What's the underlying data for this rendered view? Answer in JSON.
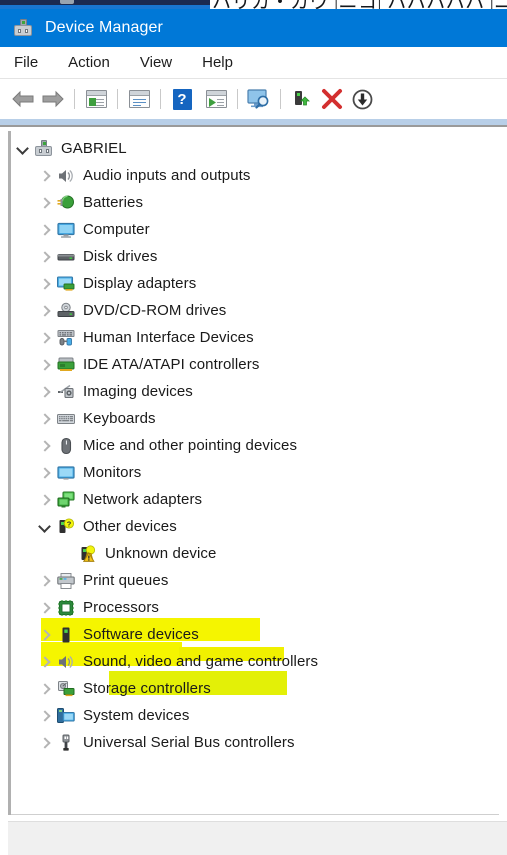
{
  "top_sliver": {
    "partial_text": "ハリカ・カウ |ニコ| ハハハハハ |ニヘ ハハ ハヘ ハハヘ"
  },
  "window": {
    "title": "Device Manager",
    "title_icon": "device-manager-icon"
  },
  "menubar": {
    "items": [
      {
        "label": "File",
        "name": "menu-file"
      },
      {
        "label": "Action",
        "name": "menu-action"
      },
      {
        "label": "View",
        "name": "menu-view"
      },
      {
        "label": "Help",
        "name": "menu-help"
      }
    ]
  },
  "toolbar": {
    "buttons": [
      {
        "icon": "back-arrow-icon",
        "tip": "Back"
      },
      {
        "icon": "forward-arrow-icon",
        "tip": "Forward"
      },
      {
        "icon": "show-hide-console-tree-icon",
        "tip": "Show/Hide console tree"
      },
      {
        "icon": "properties-icon",
        "tip": "Properties"
      },
      {
        "icon": "help-icon",
        "tip": "Help"
      },
      {
        "icon": "update-driver-software-icon",
        "tip": "Update driver"
      },
      {
        "icon": "scan-for-hardware-changes-icon",
        "tip": "Scan for hardware changes"
      },
      {
        "icon": "enable-device-icon",
        "tip": "Enable device"
      },
      {
        "icon": "uninstall-device-icon",
        "tip": "Uninstall device"
      },
      {
        "icon": "disable-device-icon",
        "tip": "Disable device"
      }
    ]
  },
  "tree": {
    "root": {
      "label": "GABRIEL",
      "icon": "computer-root-icon",
      "expanded": true
    },
    "items": [
      {
        "label": "Audio inputs and outputs",
        "icon": "speaker-icon",
        "depth": 1,
        "expanded": false,
        "highlighted": false
      },
      {
        "label": "Batteries",
        "icon": "battery-icon",
        "depth": 1,
        "expanded": false,
        "highlighted": false
      },
      {
        "label": "Computer",
        "icon": "monitor-icon",
        "depth": 1,
        "expanded": false,
        "highlighted": false
      },
      {
        "label": "Disk drives",
        "icon": "disk-drive-icon",
        "depth": 1,
        "expanded": false,
        "highlighted": false
      },
      {
        "label": "Display adapters",
        "icon": "display-adapter-icon",
        "depth": 1,
        "expanded": false,
        "highlighted": false
      },
      {
        "label": "DVD/CD-ROM drives",
        "icon": "optical-drive-icon",
        "depth": 1,
        "expanded": false,
        "highlighted": false
      },
      {
        "label": "Human Interface Devices",
        "icon": "hid-icon",
        "depth": 1,
        "expanded": false,
        "highlighted": false
      },
      {
        "label": "IDE ATA/ATAPI controllers",
        "icon": "ide-controller-icon",
        "depth": 1,
        "expanded": false,
        "highlighted": false
      },
      {
        "label": "Imaging devices",
        "icon": "imaging-device-icon",
        "depth": 1,
        "expanded": false,
        "highlighted": false
      },
      {
        "label": "Keyboards",
        "icon": "keyboard-icon",
        "depth": 1,
        "expanded": false,
        "highlighted": false
      },
      {
        "label": "Mice and other pointing devices",
        "icon": "mouse-icon",
        "depth": 1,
        "expanded": false,
        "highlighted": false
      },
      {
        "label": "Monitors",
        "icon": "monitor-icon",
        "depth": 1,
        "expanded": false,
        "highlighted": false
      },
      {
        "label": "Network adapters",
        "icon": "network-adapter-icon",
        "depth": 1,
        "expanded": false,
        "highlighted": true
      },
      {
        "label": "Other devices",
        "icon": "unknown-device-question-icon",
        "depth": 1,
        "expanded": true,
        "highlighted": true
      },
      {
        "label": "Unknown device",
        "icon": "unknown-device-warning-icon",
        "depth": 2,
        "expanded": null,
        "highlighted": true
      },
      {
        "label": "Print queues",
        "icon": "printer-icon",
        "depth": 1,
        "expanded": false,
        "highlighted": false
      },
      {
        "label": "Processors",
        "icon": "processor-icon",
        "depth": 1,
        "expanded": false,
        "highlighted": false
      },
      {
        "label": "Software devices",
        "icon": "software-device-icon",
        "depth": 1,
        "expanded": false,
        "highlighted": false
      },
      {
        "label": "Sound, video and game controllers",
        "icon": "speaker-icon",
        "depth": 1,
        "expanded": false,
        "highlighted": false
      },
      {
        "label": "Storage controllers",
        "icon": "storage-controller-icon",
        "depth": 1,
        "expanded": false,
        "highlighted": false
      },
      {
        "label": "System devices",
        "icon": "system-device-icon",
        "depth": 1,
        "expanded": false,
        "highlighted": false
      },
      {
        "label": "Universal Serial Bus controllers",
        "icon": "usb-icon",
        "depth": 1,
        "expanded": false,
        "highlighted": false
      }
    ]
  },
  "colors": {
    "titlebar": "#0078d7",
    "title_text": "#ffffff",
    "highlight_marker": "#f5f500",
    "highlight_marker_alt": "#e3f007",
    "tree_text": "#1a1a1a",
    "chevron": "#b4b4b4",
    "divider_blue": "#b8cfe8",
    "statusbar": "#f0f0f0"
  },
  "statusbar": {
    "text": ""
  }
}
